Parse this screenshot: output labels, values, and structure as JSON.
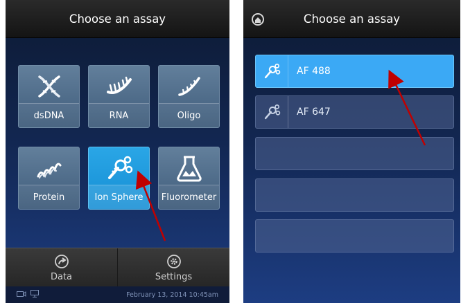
{
  "left": {
    "title": "Choose an assay",
    "tiles": [
      {
        "label": "dsDNA",
        "icon": "dna-helix-icon"
      },
      {
        "label": "RNA",
        "icon": "rna-strand-icon"
      },
      {
        "label": "Oligo",
        "icon": "oligo-strand-icon"
      },
      {
        "label": "Protein",
        "icon": "protein-coil-icon"
      },
      {
        "label": "Ion Sphere",
        "icon": "ion-sphere-icon",
        "selected": true
      },
      {
        "label": "Fluorometer",
        "icon": "flask-icon"
      }
    ],
    "bottom": {
      "data_label": "Data",
      "settings_label": "Settings"
    },
    "status": {
      "datetime": "February 13, 2014 10:45am"
    }
  },
  "right": {
    "title": "Choose an assay",
    "rows": [
      {
        "label": "AF 488",
        "selected": true
      },
      {
        "label": "AF 647"
      },
      {
        "label": ""
      },
      {
        "label": ""
      },
      {
        "label": ""
      }
    ]
  },
  "colors": {
    "selected_tile": "#158ed4",
    "selected_row": "#3ba9f5",
    "annotation_arrow": "#c00000"
  }
}
